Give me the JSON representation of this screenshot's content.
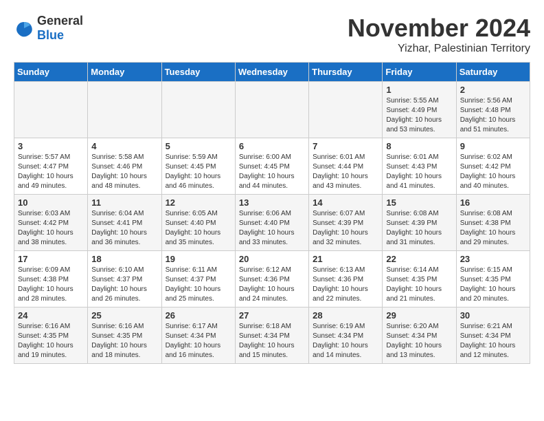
{
  "logo": {
    "general": "General",
    "blue": "Blue"
  },
  "header": {
    "month": "November 2024",
    "location": "Yizhar, Palestinian Territory"
  },
  "weekdays": [
    "Sunday",
    "Monday",
    "Tuesday",
    "Wednesday",
    "Thursday",
    "Friday",
    "Saturday"
  ],
  "weeks": [
    [
      {
        "day": "",
        "info": ""
      },
      {
        "day": "",
        "info": ""
      },
      {
        "day": "",
        "info": ""
      },
      {
        "day": "",
        "info": ""
      },
      {
        "day": "",
        "info": ""
      },
      {
        "day": "1",
        "info": "Sunrise: 5:55 AM\nSunset: 4:49 PM\nDaylight: 10 hours\nand 53 minutes."
      },
      {
        "day": "2",
        "info": "Sunrise: 5:56 AM\nSunset: 4:48 PM\nDaylight: 10 hours\nand 51 minutes."
      }
    ],
    [
      {
        "day": "3",
        "info": "Sunrise: 5:57 AM\nSunset: 4:47 PM\nDaylight: 10 hours\nand 49 minutes."
      },
      {
        "day": "4",
        "info": "Sunrise: 5:58 AM\nSunset: 4:46 PM\nDaylight: 10 hours\nand 48 minutes."
      },
      {
        "day": "5",
        "info": "Sunrise: 5:59 AM\nSunset: 4:45 PM\nDaylight: 10 hours\nand 46 minutes."
      },
      {
        "day": "6",
        "info": "Sunrise: 6:00 AM\nSunset: 4:45 PM\nDaylight: 10 hours\nand 44 minutes."
      },
      {
        "day": "7",
        "info": "Sunrise: 6:01 AM\nSunset: 4:44 PM\nDaylight: 10 hours\nand 43 minutes."
      },
      {
        "day": "8",
        "info": "Sunrise: 6:01 AM\nSunset: 4:43 PM\nDaylight: 10 hours\nand 41 minutes."
      },
      {
        "day": "9",
        "info": "Sunrise: 6:02 AM\nSunset: 4:42 PM\nDaylight: 10 hours\nand 40 minutes."
      }
    ],
    [
      {
        "day": "10",
        "info": "Sunrise: 6:03 AM\nSunset: 4:42 PM\nDaylight: 10 hours\nand 38 minutes."
      },
      {
        "day": "11",
        "info": "Sunrise: 6:04 AM\nSunset: 4:41 PM\nDaylight: 10 hours\nand 36 minutes."
      },
      {
        "day": "12",
        "info": "Sunrise: 6:05 AM\nSunset: 4:40 PM\nDaylight: 10 hours\nand 35 minutes."
      },
      {
        "day": "13",
        "info": "Sunrise: 6:06 AM\nSunset: 4:40 PM\nDaylight: 10 hours\nand 33 minutes."
      },
      {
        "day": "14",
        "info": "Sunrise: 6:07 AM\nSunset: 4:39 PM\nDaylight: 10 hours\nand 32 minutes."
      },
      {
        "day": "15",
        "info": "Sunrise: 6:08 AM\nSunset: 4:39 PM\nDaylight: 10 hours\nand 31 minutes."
      },
      {
        "day": "16",
        "info": "Sunrise: 6:08 AM\nSunset: 4:38 PM\nDaylight: 10 hours\nand 29 minutes."
      }
    ],
    [
      {
        "day": "17",
        "info": "Sunrise: 6:09 AM\nSunset: 4:38 PM\nDaylight: 10 hours\nand 28 minutes."
      },
      {
        "day": "18",
        "info": "Sunrise: 6:10 AM\nSunset: 4:37 PM\nDaylight: 10 hours\nand 26 minutes."
      },
      {
        "day": "19",
        "info": "Sunrise: 6:11 AM\nSunset: 4:37 PM\nDaylight: 10 hours\nand 25 minutes."
      },
      {
        "day": "20",
        "info": "Sunrise: 6:12 AM\nSunset: 4:36 PM\nDaylight: 10 hours\nand 24 minutes."
      },
      {
        "day": "21",
        "info": "Sunrise: 6:13 AM\nSunset: 4:36 PM\nDaylight: 10 hours\nand 22 minutes."
      },
      {
        "day": "22",
        "info": "Sunrise: 6:14 AM\nSunset: 4:35 PM\nDaylight: 10 hours\nand 21 minutes."
      },
      {
        "day": "23",
        "info": "Sunrise: 6:15 AM\nSunset: 4:35 PM\nDaylight: 10 hours\nand 20 minutes."
      }
    ],
    [
      {
        "day": "24",
        "info": "Sunrise: 6:16 AM\nSunset: 4:35 PM\nDaylight: 10 hours\nand 19 minutes."
      },
      {
        "day": "25",
        "info": "Sunrise: 6:16 AM\nSunset: 4:35 PM\nDaylight: 10 hours\nand 18 minutes."
      },
      {
        "day": "26",
        "info": "Sunrise: 6:17 AM\nSunset: 4:34 PM\nDaylight: 10 hours\nand 16 minutes."
      },
      {
        "day": "27",
        "info": "Sunrise: 6:18 AM\nSunset: 4:34 PM\nDaylight: 10 hours\nand 15 minutes."
      },
      {
        "day": "28",
        "info": "Sunrise: 6:19 AM\nSunset: 4:34 PM\nDaylight: 10 hours\nand 14 minutes."
      },
      {
        "day": "29",
        "info": "Sunrise: 6:20 AM\nSunset: 4:34 PM\nDaylight: 10 hours\nand 13 minutes."
      },
      {
        "day": "30",
        "info": "Sunrise: 6:21 AM\nSunset: 4:34 PM\nDaylight: 10 hours\nand 12 minutes."
      }
    ]
  ]
}
